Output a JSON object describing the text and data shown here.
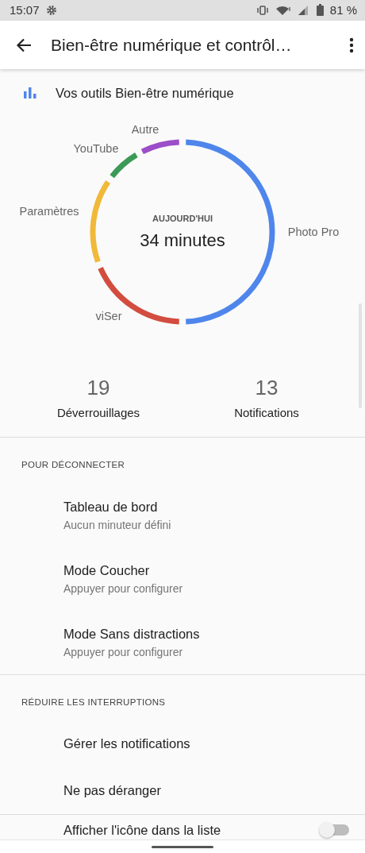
{
  "status_bar": {
    "time": "15:07",
    "battery": "81 %"
  },
  "app_bar": {
    "title": "Bien-être numérique et contrôl…"
  },
  "tools_header": {
    "label": "Vos outils Bien-être numérique"
  },
  "usage_chart": {
    "caption": "AUJOURD'HUI",
    "total": "34 minutes",
    "segments": [
      {
        "label": "Photo Pro",
        "color": "#4f86ec"
      },
      {
        "label": "viSer",
        "color": "#d24d3f"
      },
      {
        "label": "Paramètres",
        "color": "#f1b93a"
      },
      {
        "label": "YouTube",
        "color": "#3b9a56"
      },
      {
        "label": "Autre",
        "color": "#9c4dc8"
      }
    ]
  },
  "stats": [
    {
      "value": "19",
      "label": "Déverrouillages"
    },
    {
      "value": "13",
      "label": "Notifications"
    }
  ],
  "sections": [
    {
      "header": "POUR DÉCONNECTER",
      "items": [
        {
          "kind": "item",
          "title": "Tableau de bord",
          "subtitle": "Aucun minuteur défini"
        },
        {
          "kind": "item",
          "title": "Mode Coucher",
          "subtitle": "Appuyer pour configurer"
        },
        {
          "kind": "item",
          "title": "Mode Sans distractions",
          "subtitle": "Appuyer pour configurer"
        }
      ]
    },
    {
      "header": "RÉDUIRE LES INTERRUPTIONS",
      "items": [
        {
          "kind": "item",
          "title": "Gérer les notifications"
        },
        {
          "kind": "item",
          "title": "Ne pas déranger"
        },
        {
          "kind": "toggle",
          "title": "Afficher l'icône dans la liste",
          "on": false
        }
      ]
    }
  ]
}
